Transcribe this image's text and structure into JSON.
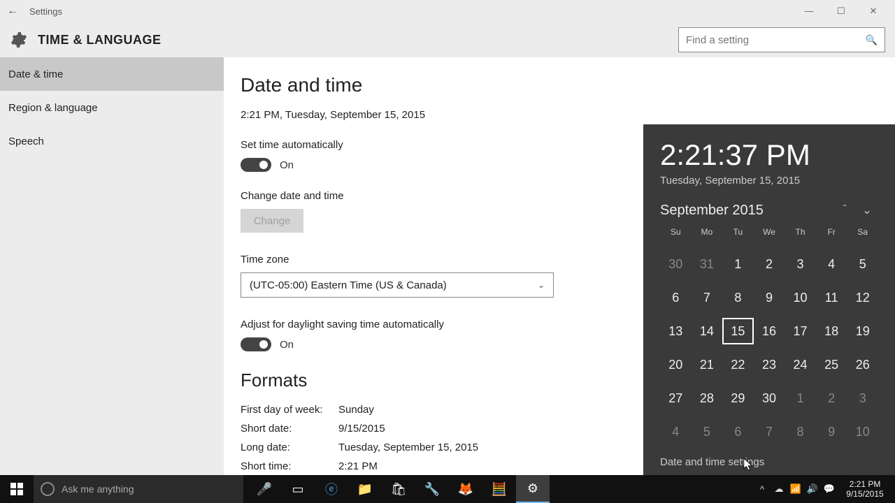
{
  "titlebar": {
    "back_icon": "←",
    "title": "Settings"
  },
  "header": {
    "title": "TIME & LANGUAGE",
    "search_placeholder": "Find a setting"
  },
  "sidebar": {
    "items": [
      {
        "label": "Date & time"
      },
      {
        "label": "Region & language"
      },
      {
        "label": "Speech"
      }
    ]
  },
  "main": {
    "heading": "Date and time",
    "datetime": "2:21 PM, Tuesday, September 15, 2015",
    "set_auto_label": "Set time automatically",
    "on": "On",
    "change_label": "Change date and time",
    "change_btn": "Change",
    "tz_label": "Time zone",
    "tz_value": "(UTC-05:00) Eastern Time (US & Canada)",
    "dst_label": "Adjust for daylight saving time automatically",
    "formats_heading": "Formats",
    "rows": [
      {
        "l": "First day of week:",
        "v": "Sunday"
      },
      {
        "l": "Short date:",
        "v": "9/15/2015"
      },
      {
        "l": "Long date:",
        "v": "Tuesday, September 15, 2015"
      },
      {
        "l": "Short time:",
        "v": "2:21 PM"
      }
    ]
  },
  "flyout": {
    "time": "2:21:37 PM",
    "date": "Tuesday, September 15, 2015",
    "month": "September 2015",
    "dh": [
      "Su",
      "Mo",
      "Tu",
      "We",
      "Th",
      "Fr",
      "Sa"
    ],
    "cells": [
      {
        "n": "30",
        "dim": true
      },
      {
        "n": "31",
        "dim": true
      },
      {
        "n": "1"
      },
      {
        "n": "2"
      },
      {
        "n": "3"
      },
      {
        "n": "4"
      },
      {
        "n": "5"
      },
      {
        "n": "6"
      },
      {
        "n": "7"
      },
      {
        "n": "8"
      },
      {
        "n": "9"
      },
      {
        "n": "10"
      },
      {
        "n": "11"
      },
      {
        "n": "12"
      },
      {
        "n": "13"
      },
      {
        "n": "14"
      },
      {
        "n": "15",
        "today": true
      },
      {
        "n": "16"
      },
      {
        "n": "17"
      },
      {
        "n": "18"
      },
      {
        "n": "19"
      },
      {
        "n": "20"
      },
      {
        "n": "21"
      },
      {
        "n": "22"
      },
      {
        "n": "23"
      },
      {
        "n": "24"
      },
      {
        "n": "25"
      },
      {
        "n": "26"
      },
      {
        "n": "27"
      },
      {
        "n": "28"
      },
      {
        "n": "29"
      },
      {
        "n": "30"
      },
      {
        "n": "1",
        "dim": true
      },
      {
        "n": "2",
        "dim": true
      },
      {
        "n": "3",
        "dim": true
      },
      {
        "n": "4",
        "dim": true
      },
      {
        "n": "5",
        "dim": true
      },
      {
        "n": "6",
        "dim": true
      },
      {
        "n": "7",
        "dim": true
      },
      {
        "n": "8",
        "dim": true
      },
      {
        "n": "9",
        "dim": true
      },
      {
        "n": "10",
        "dim": true
      }
    ],
    "link": "Date and time settings"
  },
  "taskbar": {
    "cortana": "Ask me anything",
    "clock_time": "2:21 PM",
    "clock_date": "9/15/2015"
  }
}
